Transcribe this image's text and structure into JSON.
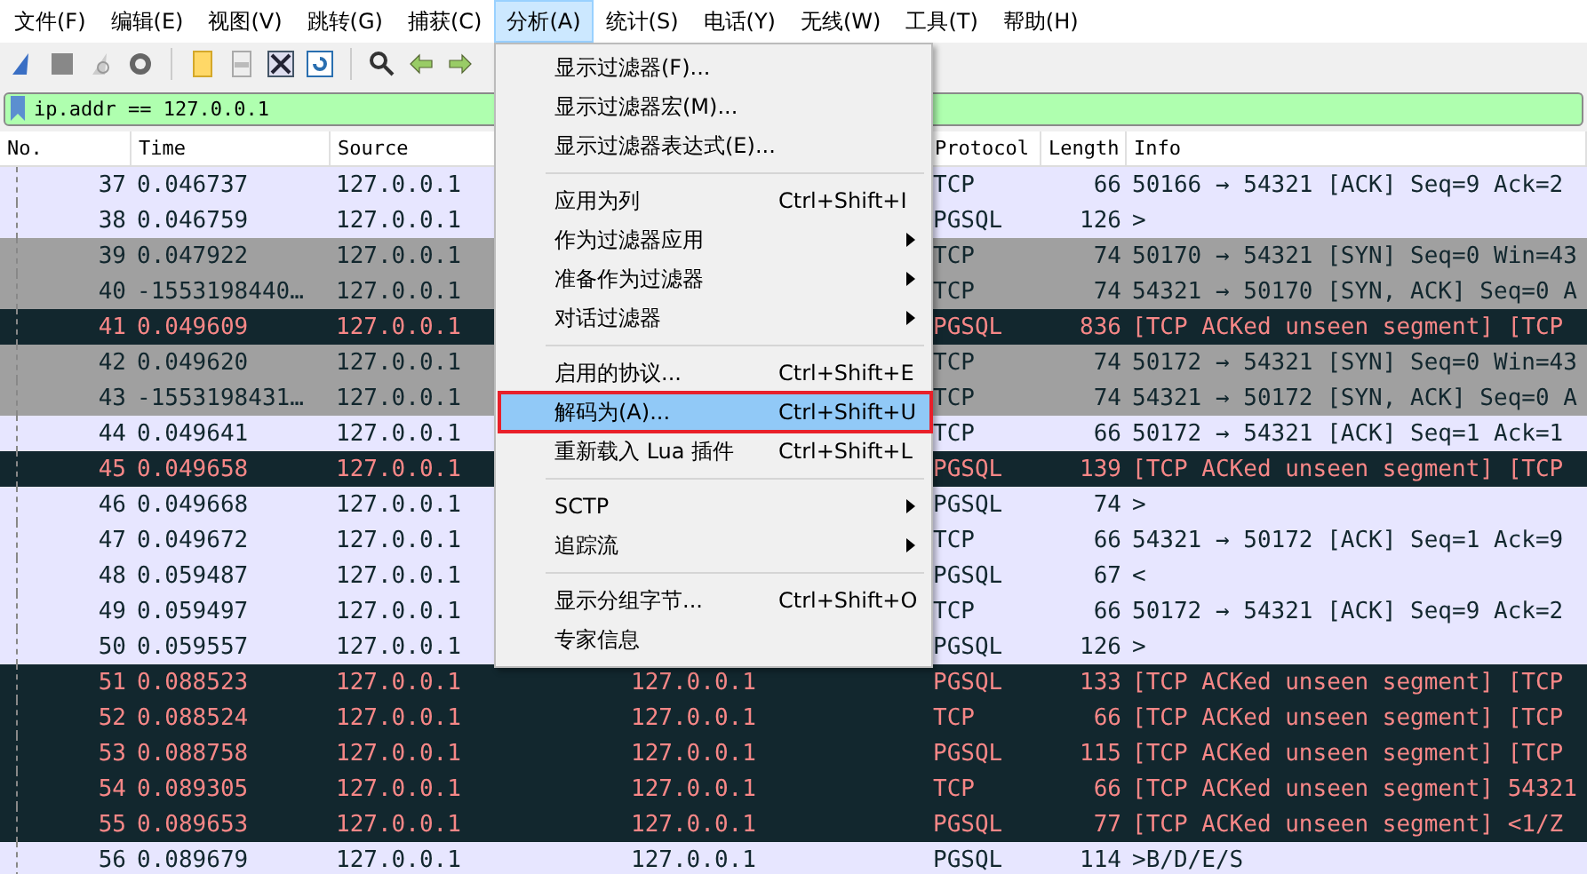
{
  "menubar": [
    {
      "label": "文件(F)",
      "selected": false
    },
    {
      "label": "编辑(E)",
      "selected": false
    },
    {
      "label": "视图(V)",
      "selected": false
    },
    {
      "label": "跳转(G)",
      "selected": false
    },
    {
      "label": "捕获(C)",
      "selected": false
    },
    {
      "label": "分析(A)",
      "selected": true
    },
    {
      "label": "统计(S)",
      "selected": false
    },
    {
      "label": "电话(Y)",
      "selected": false
    },
    {
      "label": "无线(W)",
      "selected": false
    },
    {
      "label": "工具(T)",
      "selected": false
    },
    {
      "label": "帮助(H)",
      "selected": false
    }
  ],
  "filter": {
    "value": "ip.addr == 127.0.0.1"
  },
  "table": {
    "columns": [
      "No.",
      "Time",
      "Source",
      "Protocol",
      "Length",
      "Info"
    ],
    "rows": [
      {
        "no": "37",
        "time": "0.046737",
        "source": "127.0.0.1",
        "protocol": "TCP",
        "length": "66",
        "info": "50166 → 54321 [ACK] Seq=9 Ack=2",
        "kind": "light"
      },
      {
        "no": "38",
        "time": "0.046759",
        "source": "127.0.0.1",
        "protocol": "PGSQL",
        "length": "126",
        "info": ">",
        "kind": "light"
      },
      {
        "no": "39",
        "time": "0.047922",
        "source": "127.0.0.1",
        "protocol": "TCP",
        "length": "74",
        "info": "50170 → 54321 [SYN] Seq=0 Win=43",
        "kind": "gray"
      },
      {
        "no": "40",
        "time": "-1553198440…",
        "source": "127.0.0.1",
        "protocol": "TCP",
        "length": "74",
        "info": "54321 → 50170 [SYN, ACK] Seq=0 A",
        "kind": "gray"
      },
      {
        "no": "41",
        "time": "0.049609",
        "source": "127.0.0.1",
        "protocol": "PGSQL",
        "length": "836",
        "info": "[TCP ACKed unseen segment] [TCP",
        "kind": "dark"
      },
      {
        "no": "42",
        "time": "0.049620",
        "source": "127.0.0.1",
        "protocol": "TCP",
        "length": "74",
        "info": "50172 → 54321 [SYN] Seq=0 Win=43",
        "kind": "gray"
      },
      {
        "no": "43",
        "time": "-1553198431…",
        "source": "127.0.0.1",
        "protocol": "TCP",
        "length": "74",
        "info": "54321 → 50172 [SYN, ACK] Seq=0 A",
        "kind": "gray"
      },
      {
        "no": "44",
        "time": "0.049641",
        "source": "127.0.0.1",
        "protocol": "TCP",
        "length": "66",
        "info": "50172 → 54321 [ACK] Seq=1 Ack=1",
        "kind": "light"
      },
      {
        "no": "45",
        "time": "0.049658",
        "source": "127.0.0.1",
        "protocol": "PGSQL",
        "length": "139",
        "info": "[TCP ACKed unseen segment] [TCP",
        "kind": "dark"
      },
      {
        "no": "46",
        "time": "0.049668",
        "source": "127.0.0.1",
        "protocol": "PGSQL",
        "length": "74",
        "info": ">",
        "kind": "light"
      },
      {
        "no": "47",
        "time": "0.049672",
        "source": "127.0.0.1",
        "protocol": "TCP",
        "length": "66",
        "info": "54321 → 50172 [ACK] Seq=1 Ack=9",
        "kind": "light"
      },
      {
        "no": "48",
        "time": "0.059487",
        "source": "127.0.0.1",
        "protocol": "PGSQL",
        "length": "67",
        "info": "<",
        "kind": "light"
      },
      {
        "no": "49",
        "time": "0.059497",
        "source": "127.0.0.1",
        "protocol": "TCP",
        "length": "66",
        "info": "50172 → 54321 [ACK] Seq=9 Ack=2",
        "kind": "light"
      },
      {
        "no": "50",
        "time": "0.059557",
        "source": "127.0.0.1",
        "protocol": "PGSQL",
        "length": "126",
        "info": ">",
        "kind": "light"
      },
      {
        "no": "51",
        "time": "0.088523",
        "source": "127.0.0.1",
        "destination": "127.0.0.1",
        "protocol": "PGSQL",
        "length": "133",
        "info": "[TCP ACKed unseen segment] [TCP",
        "kind": "dark"
      },
      {
        "no": "52",
        "time": "0.088524",
        "source": "127.0.0.1",
        "destination": "127.0.0.1",
        "protocol": "TCP",
        "length": "66",
        "info": "[TCP ACKed unseen segment] [TCP",
        "kind": "dark"
      },
      {
        "no": "53",
        "time": "0.088758",
        "source": "127.0.0.1",
        "destination": "127.0.0.1",
        "protocol": "PGSQL",
        "length": "115",
        "info": "[TCP ACKed unseen segment] [TCP",
        "kind": "dark"
      },
      {
        "no": "54",
        "time": "0.089305",
        "source": "127.0.0.1",
        "destination": "127.0.0.1",
        "protocol": "TCP",
        "length": "66",
        "info": "[TCP ACKed unseen segment] 54321",
        "kind": "dark"
      },
      {
        "no": "55",
        "time": "0.089653",
        "source": "127.0.0.1",
        "destination": "127.0.0.1",
        "protocol": "PGSQL",
        "length": "77",
        "info": "[TCP ACKed unseen segment] <1/Z",
        "kind": "dark"
      },
      {
        "no": "56",
        "time": "0.089679",
        "source": "127.0.0.1",
        "destination": "127.0.0.1",
        "protocol": "PGSQL",
        "length": "114",
        "info": ">B/D/E/S",
        "kind": "light"
      }
    ]
  },
  "dropdown_menu": {
    "groups": [
      [
        {
          "label": "显示过滤器(F)...",
          "submenu": false,
          "selected": false,
          "outlined": false
        },
        {
          "label": "显示过滤器宏(M)...",
          "submenu": false,
          "selected": false,
          "outlined": false
        },
        {
          "label": "显示过滤器表达式(E)...",
          "submenu": false,
          "selected": false,
          "outlined": false
        }
      ],
      [
        {
          "label": "应用为列",
          "shortcut": "Ctrl+Shift+I",
          "submenu": false,
          "selected": false,
          "outlined": false
        },
        {
          "label": "作为过滤器应用",
          "submenu": true,
          "selected": false,
          "outlined": false
        },
        {
          "label": "准备作为过滤器",
          "submenu": true,
          "selected": false,
          "outlined": false
        },
        {
          "label": "对话过滤器",
          "submenu": true,
          "selected": false,
          "outlined": false
        }
      ],
      [
        {
          "label": "启用的协议...",
          "shortcut": "Ctrl+Shift+E",
          "submenu": false,
          "selected": false,
          "outlined": false
        },
        {
          "label": "解码为(A)...",
          "shortcut": "Ctrl+Shift+U",
          "submenu": false,
          "selected": true,
          "outlined": true
        },
        {
          "label": "重新载入 Lua 插件",
          "shortcut": "Ctrl+Shift+L",
          "submenu": false,
          "selected": false,
          "outlined": false
        }
      ],
      [
        {
          "label": "SCTP",
          "submenu": true,
          "selected": false,
          "outlined": false
        },
        {
          "label": "追踪流",
          "submenu": true,
          "selected": false,
          "outlined": false
        }
      ],
      [
        {
          "label": "显示分组字节...",
          "shortcut": "Ctrl+Shift+O",
          "submenu": false,
          "selected": false,
          "outlined": false
        },
        {
          "label": "专家信息",
          "submenu": false,
          "selected": false,
          "outlined": false
        }
      ]
    ]
  }
}
